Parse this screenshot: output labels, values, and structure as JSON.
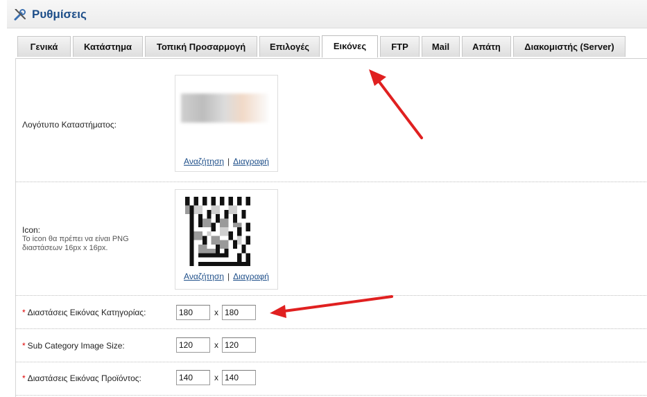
{
  "header": {
    "title": "Ρυθμίσεις",
    "icon": "wrench-screwdriver-icon"
  },
  "tabs": [
    {
      "label": "Γενικά",
      "active": false
    },
    {
      "label": "Κατάστημα",
      "active": false
    },
    {
      "label": "Τοπική Προσαρμογή",
      "active": false
    },
    {
      "label": "Επιλογές",
      "active": false
    },
    {
      "label": "Εικόνες",
      "active": true
    },
    {
      "label": "FTP",
      "active": false
    },
    {
      "label": "Mail",
      "active": false
    },
    {
      "label": "Απάτη",
      "active": false
    },
    {
      "label": "Διακομιστής (Server)",
      "active": false
    }
  ],
  "logo": {
    "label": "Λογότυπο Καταστήματος:",
    "browse_link": "Αναζήτηση",
    "separator": "|",
    "delete_link": "Διαγραφή"
  },
  "icon_setting": {
    "label": "Icon:",
    "note_line1": "Το icon θα πρέπει να είναι PNG",
    "note_line2": "διαστάσεων 16px x 16px.",
    "browse_link": "Αναζήτηση",
    "separator": "|",
    "delete_link": "Διαγραφή"
  },
  "sizes": [
    {
      "required_mark": "*",
      "label": "Διαστάσεις Εικόνας Κατηγορίας:",
      "width": "180",
      "times": "x",
      "height": "180"
    },
    {
      "required_mark": "*",
      "label": "Sub Category Image Size:",
      "width": "120",
      "times": "x",
      "height": "120"
    },
    {
      "required_mark": "*",
      "label": "Διαστάσεις Εικόνας Προϊόντος:",
      "width": "140",
      "times": "x",
      "height": "140"
    }
  ],
  "colors": {
    "accent": "#1d4e89",
    "required": "#dd0000",
    "annotation_arrow": "#e02020"
  }
}
